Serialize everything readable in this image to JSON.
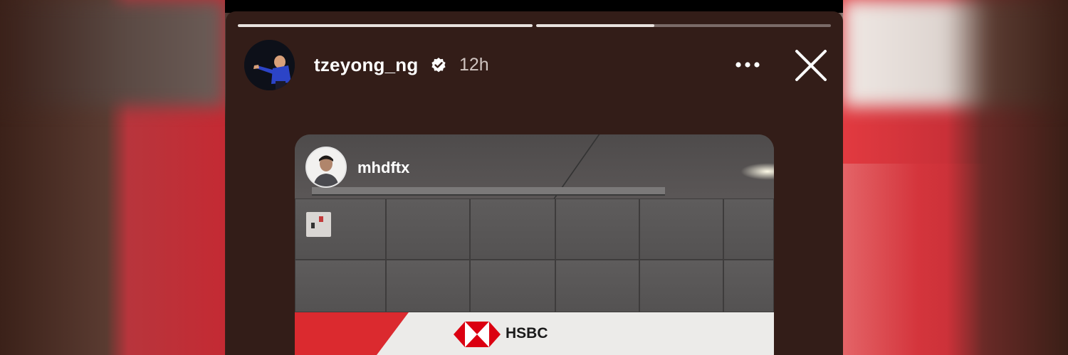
{
  "story": {
    "username": "tzeyong_ng",
    "time": "12h",
    "progress": [
      1.0,
      0.4
    ]
  },
  "shared_post": {
    "username": "mhdftx",
    "sign_text": "HSBC"
  },
  "colors": {
    "story_bg": "#331d18",
    "brand_red": "#db2a2f",
    "verified_blue": "#ffffff"
  },
  "icons": [
    "verified-badge-icon",
    "more-options-icon",
    "close-icon"
  ]
}
